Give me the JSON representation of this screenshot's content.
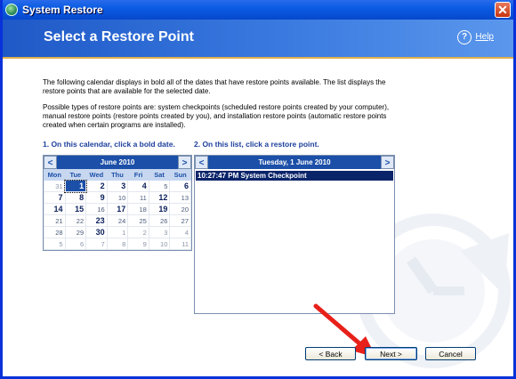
{
  "window": {
    "title": "System Restore"
  },
  "header": {
    "title": "Select a Restore Point",
    "help_label": "Help",
    "help_icon_glyph": "?"
  },
  "intro_text": "The following calendar displays in bold all of the dates that have restore points available. The list displays the restore points that are available for the selected date.",
  "types_text": "Possible types of restore points are: system checkpoints (scheduled restore points created by your computer), manual restore points (restore points created by you), and installation restore points (automatic restore points created when certain programs are installed).",
  "step1": "1. On this calendar, click a bold date.",
  "step2": "2. On this list, click a restore point.",
  "calendar": {
    "month_label": "June 2010",
    "prev": "<",
    "next": ">",
    "weekdays": [
      "Mon",
      "Tue",
      "Wed",
      "Thu",
      "Fri",
      "Sat",
      "Sun"
    ],
    "weeks": [
      [
        {
          "d": "31",
          "t": "other"
        },
        {
          "d": "1",
          "t": "selected"
        },
        {
          "d": "2",
          "t": "bold"
        },
        {
          "d": "3",
          "t": "bold"
        },
        {
          "d": "4",
          "t": "bold"
        },
        {
          "d": "5",
          "t": ""
        },
        {
          "d": "6",
          "t": "bold"
        }
      ],
      [
        {
          "d": "7",
          "t": "bold"
        },
        {
          "d": "8",
          "t": "bold"
        },
        {
          "d": "9",
          "t": "bold"
        },
        {
          "d": "10",
          "t": ""
        },
        {
          "d": "11",
          "t": ""
        },
        {
          "d": "12",
          "t": "bold"
        },
        {
          "d": "13",
          "t": ""
        }
      ],
      [
        {
          "d": "14",
          "t": "bold"
        },
        {
          "d": "15",
          "t": "bold"
        },
        {
          "d": "16",
          "t": ""
        },
        {
          "d": "17",
          "t": "bold"
        },
        {
          "d": "18",
          "t": ""
        },
        {
          "d": "19",
          "t": "bold"
        },
        {
          "d": "20",
          "t": ""
        }
      ],
      [
        {
          "d": "21",
          "t": ""
        },
        {
          "d": "22",
          "t": ""
        },
        {
          "d": "23",
          "t": "bold"
        },
        {
          "d": "24",
          "t": ""
        },
        {
          "d": "25",
          "t": ""
        },
        {
          "d": "26",
          "t": ""
        },
        {
          "d": "27",
          "t": ""
        }
      ],
      [
        {
          "d": "28",
          "t": ""
        },
        {
          "d": "29",
          "t": ""
        },
        {
          "d": "30",
          "t": "bold"
        },
        {
          "d": "1",
          "t": "other"
        },
        {
          "d": "2",
          "t": "other"
        },
        {
          "d": "3",
          "t": "other"
        },
        {
          "d": "4",
          "t": "other"
        }
      ],
      [
        {
          "d": "5",
          "t": "other"
        },
        {
          "d": "6",
          "t": "other"
        },
        {
          "d": "7",
          "t": "other"
        },
        {
          "d": "8",
          "t": "other"
        },
        {
          "d": "9",
          "t": "other"
        },
        {
          "d": "10",
          "t": "other"
        },
        {
          "d": "11",
          "t": "other"
        }
      ]
    ]
  },
  "restore_list": {
    "date_label": "Tuesday, 1 June 2010",
    "prev": "<",
    "next": ">",
    "items": [
      "10:27:47 PM  System Checkpoint"
    ]
  },
  "buttons": {
    "back": "< Back",
    "next": "Next >",
    "cancel": "Cancel"
  },
  "colors": {
    "accent": "#1b4fa8",
    "title_bar": "#0a5ce3",
    "arrow": "#e8201a"
  }
}
